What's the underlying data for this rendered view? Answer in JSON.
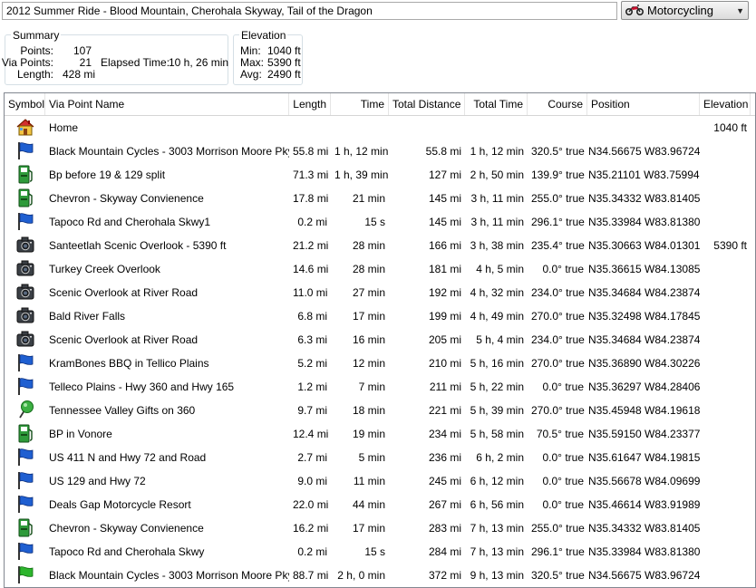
{
  "route_name": "2012 Summer Ride - Blood Mountain, Cherohala Skyway, Tail of the Dragon",
  "profile": {
    "label": "Motorcycling"
  },
  "summary": {
    "title": "Summary",
    "points_label": "Points:",
    "points": "107",
    "via_label": "Via Points:",
    "via": "21",
    "elapsed_label": "Elapsed Time:",
    "elapsed": "10 h, 26 min",
    "length_label": "Length:",
    "length": "428 mi"
  },
  "elevation": {
    "title": "Elevation",
    "min_label": "Min:",
    "min": "1040 ft",
    "max_label": "Max:",
    "max": "5390 ft",
    "avg_label": "Avg:",
    "avg": "2490 ft"
  },
  "columns": [
    "Symbol",
    "Via Point Name",
    "Length",
    "Time",
    "Total Distance",
    "Total Time",
    "Course",
    "Position",
    "Elevation"
  ],
  "rows": [
    {
      "icon": "house-icon",
      "name": "Home",
      "length": "",
      "time": "",
      "total_distance": "",
      "total_time": "",
      "course": "",
      "position": "",
      "elevation": "1040 ft"
    },
    {
      "icon": "blue-flag-icon",
      "name": "Black Mountain Cycles - 3003 Morrison Moore Pky",
      "length": "55.8 mi",
      "time": "1 h, 12 min",
      "total_distance": "55.8 mi",
      "total_time": "1 h, 12 min",
      "course": "320.5° true",
      "position": "N34.56675 W83.96724",
      "elevation": ""
    },
    {
      "icon": "gas-station-icon",
      "name": "Bp before 19 & 129 split",
      "length": "71.3 mi",
      "time": "1 h, 39 min",
      "total_distance": "127 mi",
      "total_time": "2 h, 50 min",
      "course": "139.9° true",
      "position": "N35.21101 W83.75994",
      "elevation": ""
    },
    {
      "icon": "gas-station-icon",
      "name": "Chevron - Skyway Convienence",
      "length": "17.8 mi",
      "time": "21 min",
      "total_distance": "145 mi",
      "total_time": "3 h, 11 min",
      "course": "255.0° true",
      "position": "N35.34332 W83.81405",
      "elevation": ""
    },
    {
      "icon": "blue-flag-icon",
      "name": "Tapoco Rd and Cherohala Skwy1",
      "length": "0.2 mi",
      "time": "15 s",
      "total_distance": "145 mi",
      "total_time": "3 h, 11 min",
      "course": "296.1° true",
      "position": "N35.33984 W83.81380",
      "elevation": ""
    },
    {
      "icon": "camera-icon",
      "name": "Santeetlah Scenic Overlook - 5390 ft",
      "length": "21.2 mi",
      "time": "28 min",
      "total_distance": "166 mi",
      "total_time": "3 h, 38 min",
      "course": "235.4° true",
      "position": "N35.30663 W84.01301",
      "elevation": "5390 ft"
    },
    {
      "icon": "camera-icon",
      "name": "Turkey Creek Overlook",
      "length": "14.6 mi",
      "time": "28 min",
      "total_distance": "181 mi",
      "total_time": "4 h, 5 min",
      "course": "0.0° true",
      "position": "N35.36615 W84.13085",
      "elevation": ""
    },
    {
      "icon": "camera-icon",
      "name": "Scenic Overlook at River Road",
      "length": "11.0 mi",
      "time": "27 min",
      "total_distance": "192 mi",
      "total_time": "4 h, 32 min",
      "course": "234.0° true",
      "position": "N35.34684 W84.23874",
      "elevation": ""
    },
    {
      "icon": "camera-icon",
      "name": "Bald River Falls",
      "length": "6.8 mi",
      "time": "17 min",
      "total_distance": "199 mi",
      "total_time": "4 h, 49 min",
      "course": "270.0° true",
      "position": "N35.32498 W84.17845",
      "elevation": ""
    },
    {
      "icon": "camera-icon",
      "name": "Scenic Overlook at River Road",
      "length": "6.3 mi",
      "time": "16 min",
      "total_distance": "205 mi",
      "total_time": "5 h, 4 min",
      "course": "234.0° true",
      "position": "N35.34684 W84.23874",
      "elevation": ""
    },
    {
      "icon": "blue-flag-icon",
      "name": "KramBones BBQ in Tellico Plains",
      "length": "5.2 mi",
      "time": "12 min",
      "total_distance": "210 mi",
      "total_time": "5 h, 16 min",
      "course": "270.0° true",
      "position": "N35.36890 W84.30226",
      "elevation": ""
    },
    {
      "icon": "blue-flag-icon",
      "name": "Telleco Plains - Hwy 360 and Hwy 165",
      "length": "1.2 mi",
      "time": "7 min",
      "total_distance": "211 mi",
      "total_time": "5 h, 22 min",
      "course": "0.0° true",
      "position": "N35.36297 W84.28406",
      "elevation": ""
    },
    {
      "icon": "green-pin-icon",
      "name": "Tennessee Valley Gifts on 360",
      "length": "9.7 mi",
      "time": "18 min",
      "total_distance": "221 mi",
      "total_time": "5 h, 39 min",
      "course": "270.0° true",
      "position": "N35.45948 W84.19618",
      "elevation": ""
    },
    {
      "icon": "gas-station-icon",
      "name": "BP in Vonore",
      "length": "12.4 mi",
      "time": "19 min",
      "total_distance": "234 mi",
      "total_time": "5 h, 58 min",
      "course": "70.5° true",
      "position": "N35.59150 W84.23377",
      "elevation": ""
    },
    {
      "icon": "blue-flag-icon",
      "name": "US 411 N and Hwy 72 and Road",
      "length": "2.7 mi",
      "time": "5 min",
      "total_distance": "236 mi",
      "total_time": "6 h, 2 min",
      "course": "0.0° true",
      "position": "N35.61647 W84.19815",
      "elevation": ""
    },
    {
      "icon": "blue-flag-icon",
      "name": "US 129 and Hwy 72",
      "length": "9.0 mi",
      "time": "11 min",
      "total_distance": "245 mi",
      "total_time": "6 h, 12 min",
      "course": "0.0° true",
      "position": "N35.56678 W84.09699",
      "elevation": ""
    },
    {
      "icon": "blue-flag-icon",
      "name": "Deals Gap Motorcycle Resort",
      "length": "22.0 mi",
      "time": "44 min",
      "total_distance": "267 mi",
      "total_time": "6 h, 56 min",
      "course": "0.0° true",
      "position": "N35.46614 W83.91989",
      "elevation": ""
    },
    {
      "icon": "gas-station-icon",
      "name": "Chevron - Skyway Convienence",
      "length": "16.2 mi",
      "time": "17 min",
      "total_distance": "283 mi",
      "total_time": "7 h, 13 min",
      "course": "255.0° true",
      "position": "N35.34332 W83.81405",
      "elevation": ""
    },
    {
      "icon": "blue-flag-icon",
      "name": "Tapoco Rd and Cherohala Skwy",
      "length": "0.2 mi",
      "time": "15 s",
      "total_distance": "284 mi",
      "total_time": "7 h, 13 min",
      "course": "296.1° true",
      "position": "N35.33984 W83.81380",
      "elevation": ""
    },
    {
      "icon": "green-flag-icon",
      "name": "Black Mountain Cycles - 3003 Morrison Moore Pky",
      "length": "88.7 mi",
      "time": "2 h, 0 min",
      "total_distance": "372 mi",
      "total_time": "9 h, 13 min",
      "course": "320.5° true",
      "position": "N34.56675 W83.96724",
      "elevation": ""
    }
  ]
}
